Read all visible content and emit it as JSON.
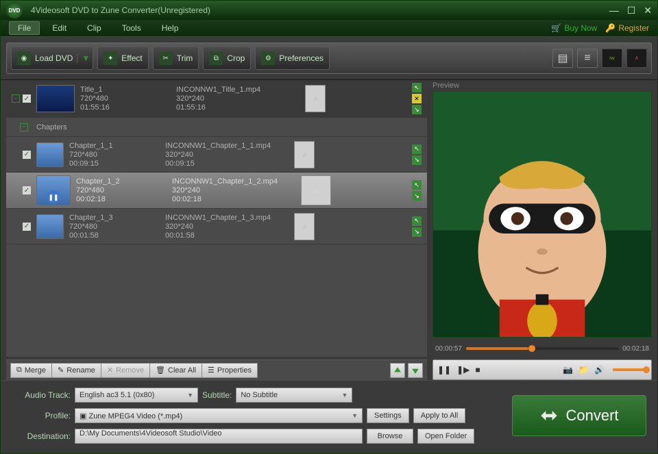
{
  "window": {
    "title": "4Videosoft DVD to Zune Converter(Unregistered)",
    "logo_text": "DVD"
  },
  "menu": {
    "file": "File",
    "edit": "Edit",
    "clip": "Clip",
    "tools": "Tools",
    "help": "Help",
    "buy": "Buy Now",
    "register": "Register"
  },
  "toolbar": {
    "load": "Load DVD",
    "effect": "Effect",
    "trim": "Trim",
    "crop": "Crop",
    "prefs": "Preferences"
  },
  "list": {
    "title": {
      "name": "Title_1",
      "res": "720*480",
      "dur": "01:55:16",
      "out_name": "INCONNW1_Title_1.mp4",
      "out_res": "320*240",
      "out_dur": "01:55:16"
    },
    "chapters_label": "Chapters",
    "items": [
      {
        "name": "Chapter_1_1",
        "res": "720*480",
        "dur": "00:09:15",
        "out_name": "INCONNW1_Chapter_1_1.mp4",
        "out_res": "320*240",
        "out_dur": "00:09:15"
      },
      {
        "name": "Chapter_1_2",
        "res": "720*480",
        "dur": "00:02:18",
        "out_name": "INCONNW1_Chapter_1_2.mp4",
        "out_res": "320*240",
        "out_dur": "00:02:18"
      },
      {
        "name": "Chapter_1_3",
        "res": "720*480",
        "dur": "00:01:58",
        "out_name": "INCONNW1_Chapter_1_3.mp4",
        "out_res": "320*240",
        "out_dur": "00:01:58"
      }
    ]
  },
  "list_toolbar": {
    "merge": "Merge",
    "rename": "Rename",
    "remove": "Remove",
    "clear": "Clear All",
    "props": "Properties"
  },
  "preview": {
    "label": "Preview",
    "cur_time": "00:00:57",
    "total_time": "00:02:18",
    "progress_pct": 41
  },
  "settings": {
    "audio_label": "Audio Track:",
    "audio_value": "English ac3 5.1 (0x80)",
    "subtitle_label": "Subtitle:",
    "subtitle_value": "No Subtitle",
    "profile_label": "Profile:",
    "profile_value": "Zune MPEG4 Video (*.mp4)",
    "settings_btn": "Settings",
    "apply_btn": "Apply to All",
    "dest_label": "Destination:",
    "dest_value": "D:\\My Documents\\4Videosoft Studio\\Video",
    "browse": "Browse",
    "open_folder": "Open Folder"
  },
  "convert": "Convert"
}
